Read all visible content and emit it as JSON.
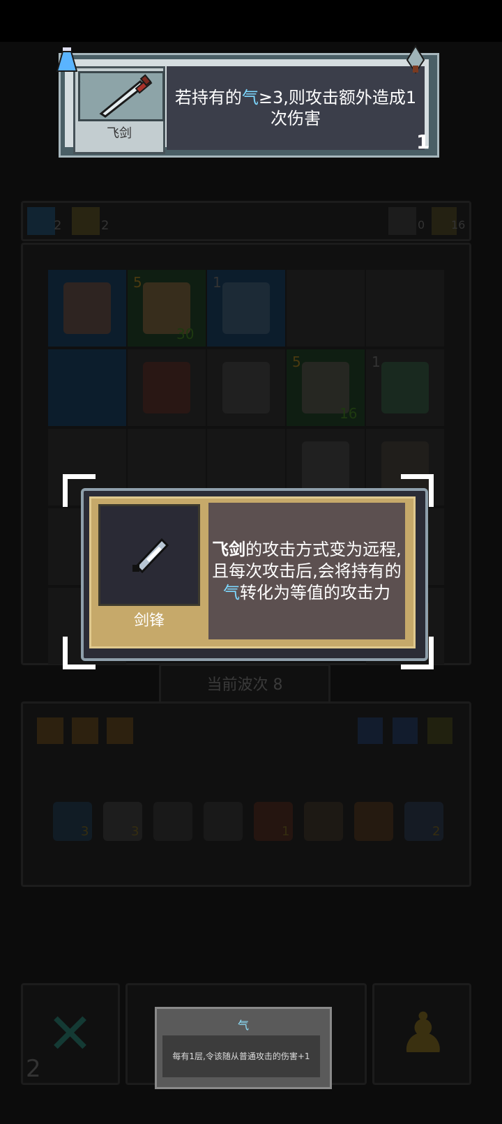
{
  "top_tooltip": {
    "item_name": "飞剑",
    "desc_pre": "若持有的",
    "desc_hl": "气",
    "desc_post": "≥3,则攻击额外造成1次伤害",
    "count": "1"
  },
  "resources": {
    "left_counts": [
      "2",
      "2"
    ],
    "right_counts": [
      "0",
      "16"
    ]
  },
  "board": {
    "unit_badges": [
      "5",
      "1",
      "5",
      "1"
    ],
    "unit_numbers": [
      "30",
      "16"
    ],
    "wave_label": "当前波次 8"
  },
  "inventory": {
    "item_counts": [
      "3",
      "3",
      "1",
      "2"
    ]
  },
  "skill_card": {
    "name": "剑锋",
    "desc_prefix": "飞剑",
    "desc_middle": "的攻击方式变为远程,且每次攻击后,会将持有的",
    "desc_hl": "气",
    "desc_suffix": "转化为等值的攻击力"
  },
  "bottom_tooltip": {
    "title": "气",
    "body": "每有1层,令该随从普通攻击的伤害+1"
  },
  "bottom_bar": {
    "left_count": "2"
  },
  "colors": {
    "highlight": "#7dd8ff",
    "gold": "#c6a96a",
    "card_bg": "#3b3e4a"
  }
}
